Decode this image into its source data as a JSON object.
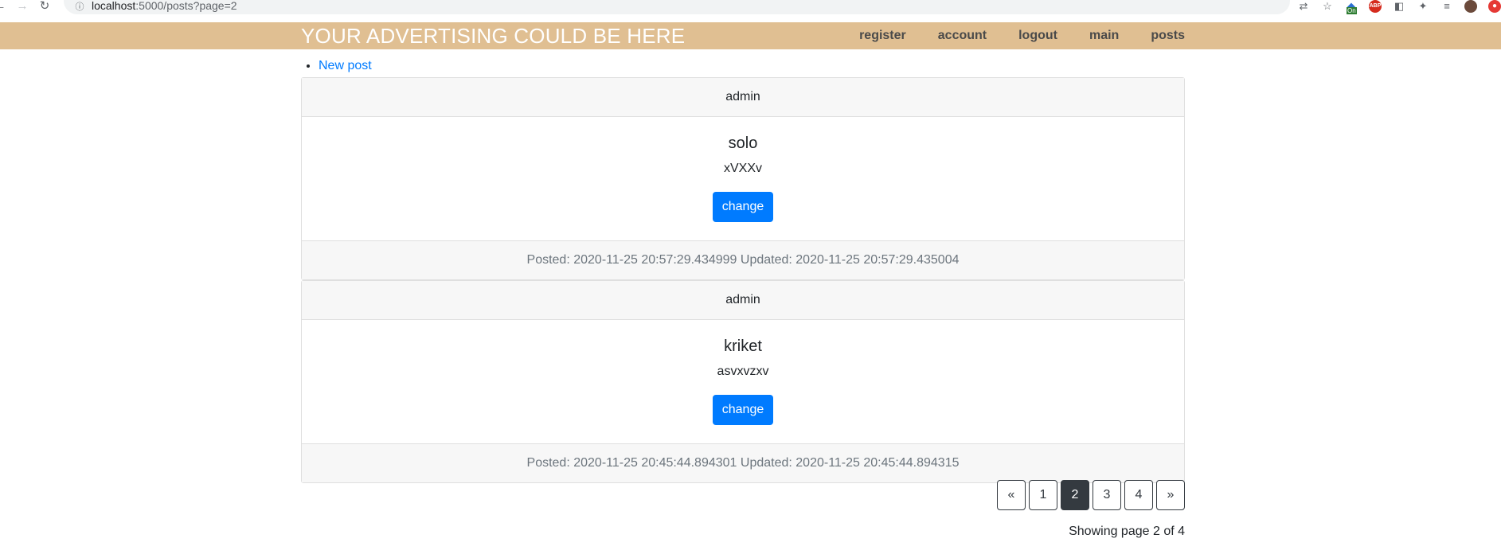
{
  "browser": {
    "url_host": "localhost",
    "url_rest": ":5000/posts?page=2"
  },
  "header": {
    "brand": "YOUR ADVERTISING COULD BE HERE",
    "nav": [
      {
        "label": "register"
      },
      {
        "label": "account"
      },
      {
        "label": "logout"
      },
      {
        "label": "main"
      },
      {
        "label": "posts"
      }
    ]
  },
  "actions": {
    "new_post": "New post"
  },
  "posts": [
    {
      "author": "admin",
      "title": "solo",
      "body": "xVXXv",
      "button": "change",
      "footer": "Posted: 2020-11-25 20:57:29.434999 Updated: 2020-11-25 20:57:29.435004"
    },
    {
      "author": "admin",
      "title": "kriket",
      "body": "asvxvzxv",
      "button": "change",
      "footer": "Posted: 2020-11-25 20:45:44.894301 Updated: 2020-11-25 20:45:44.894315"
    }
  ],
  "pagination": {
    "prev": "«",
    "pages": [
      "1",
      "2",
      "3",
      "4"
    ],
    "current": "2",
    "next": "»",
    "info": "Showing page 2 of 4"
  },
  "colors": {
    "header_bg": "#e0bf92",
    "primary": "#007bff",
    "pager_active": "#343a40"
  },
  "icons": [
    "back-arrow-icon",
    "forward-arrow-icon",
    "reload-icon",
    "info-icon",
    "translate-icon",
    "star-icon",
    "extension-on-icon",
    "adblock-icon",
    "extension-icon",
    "puzzle-icon",
    "media-icon",
    "profile-avatar",
    "notification-icon"
  ]
}
